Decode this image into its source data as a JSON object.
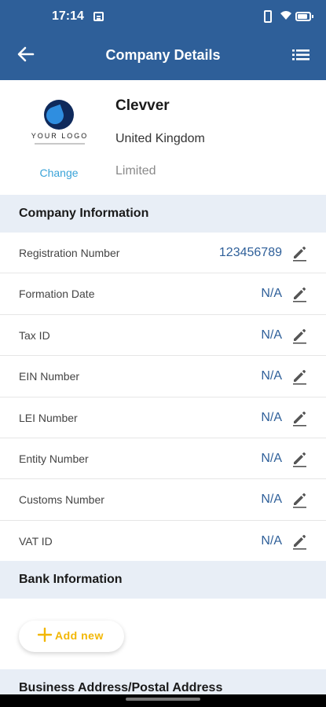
{
  "status_bar": {
    "time": "17:14"
  },
  "header": {
    "title": "Company Details"
  },
  "company": {
    "logo_text": "YOUR LOGO",
    "change_label": "Change",
    "name": "Clevver",
    "country": "United Kingdom",
    "type": "Limited"
  },
  "sections": {
    "company_info": "Company Information",
    "bank_info": "Bank Information",
    "address": "Business Address/Postal Address"
  },
  "company_info_rows": [
    {
      "label": "Registration Number",
      "value": "123456789"
    },
    {
      "label": "Formation Date",
      "value": "N/A"
    },
    {
      "label": "Tax ID",
      "value": "N/A"
    },
    {
      "label": "EIN Number",
      "value": "N/A"
    },
    {
      "label": "LEI Number",
      "value": "N/A"
    },
    {
      "label": "Entity Number",
      "value": "N/A"
    },
    {
      "label": "Customs Number",
      "value": "N/A"
    },
    {
      "label": "VAT ID",
      "value": "N/A"
    }
  ],
  "bank": {
    "add_label": "Add new"
  },
  "icons": {
    "back": "arrow-left-icon",
    "menu": "list-menu-icon",
    "edit": "pencil-icon",
    "add": "plus-icon"
  },
  "colors": {
    "header": "#2e5f99",
    "section_bg": "#e8eef6",
    "value_text": "#2e5f99",
    "link": "#3aa3d8",
    "add_accent": "#f2b705"
  },
  "battery_level": 0.85
}
